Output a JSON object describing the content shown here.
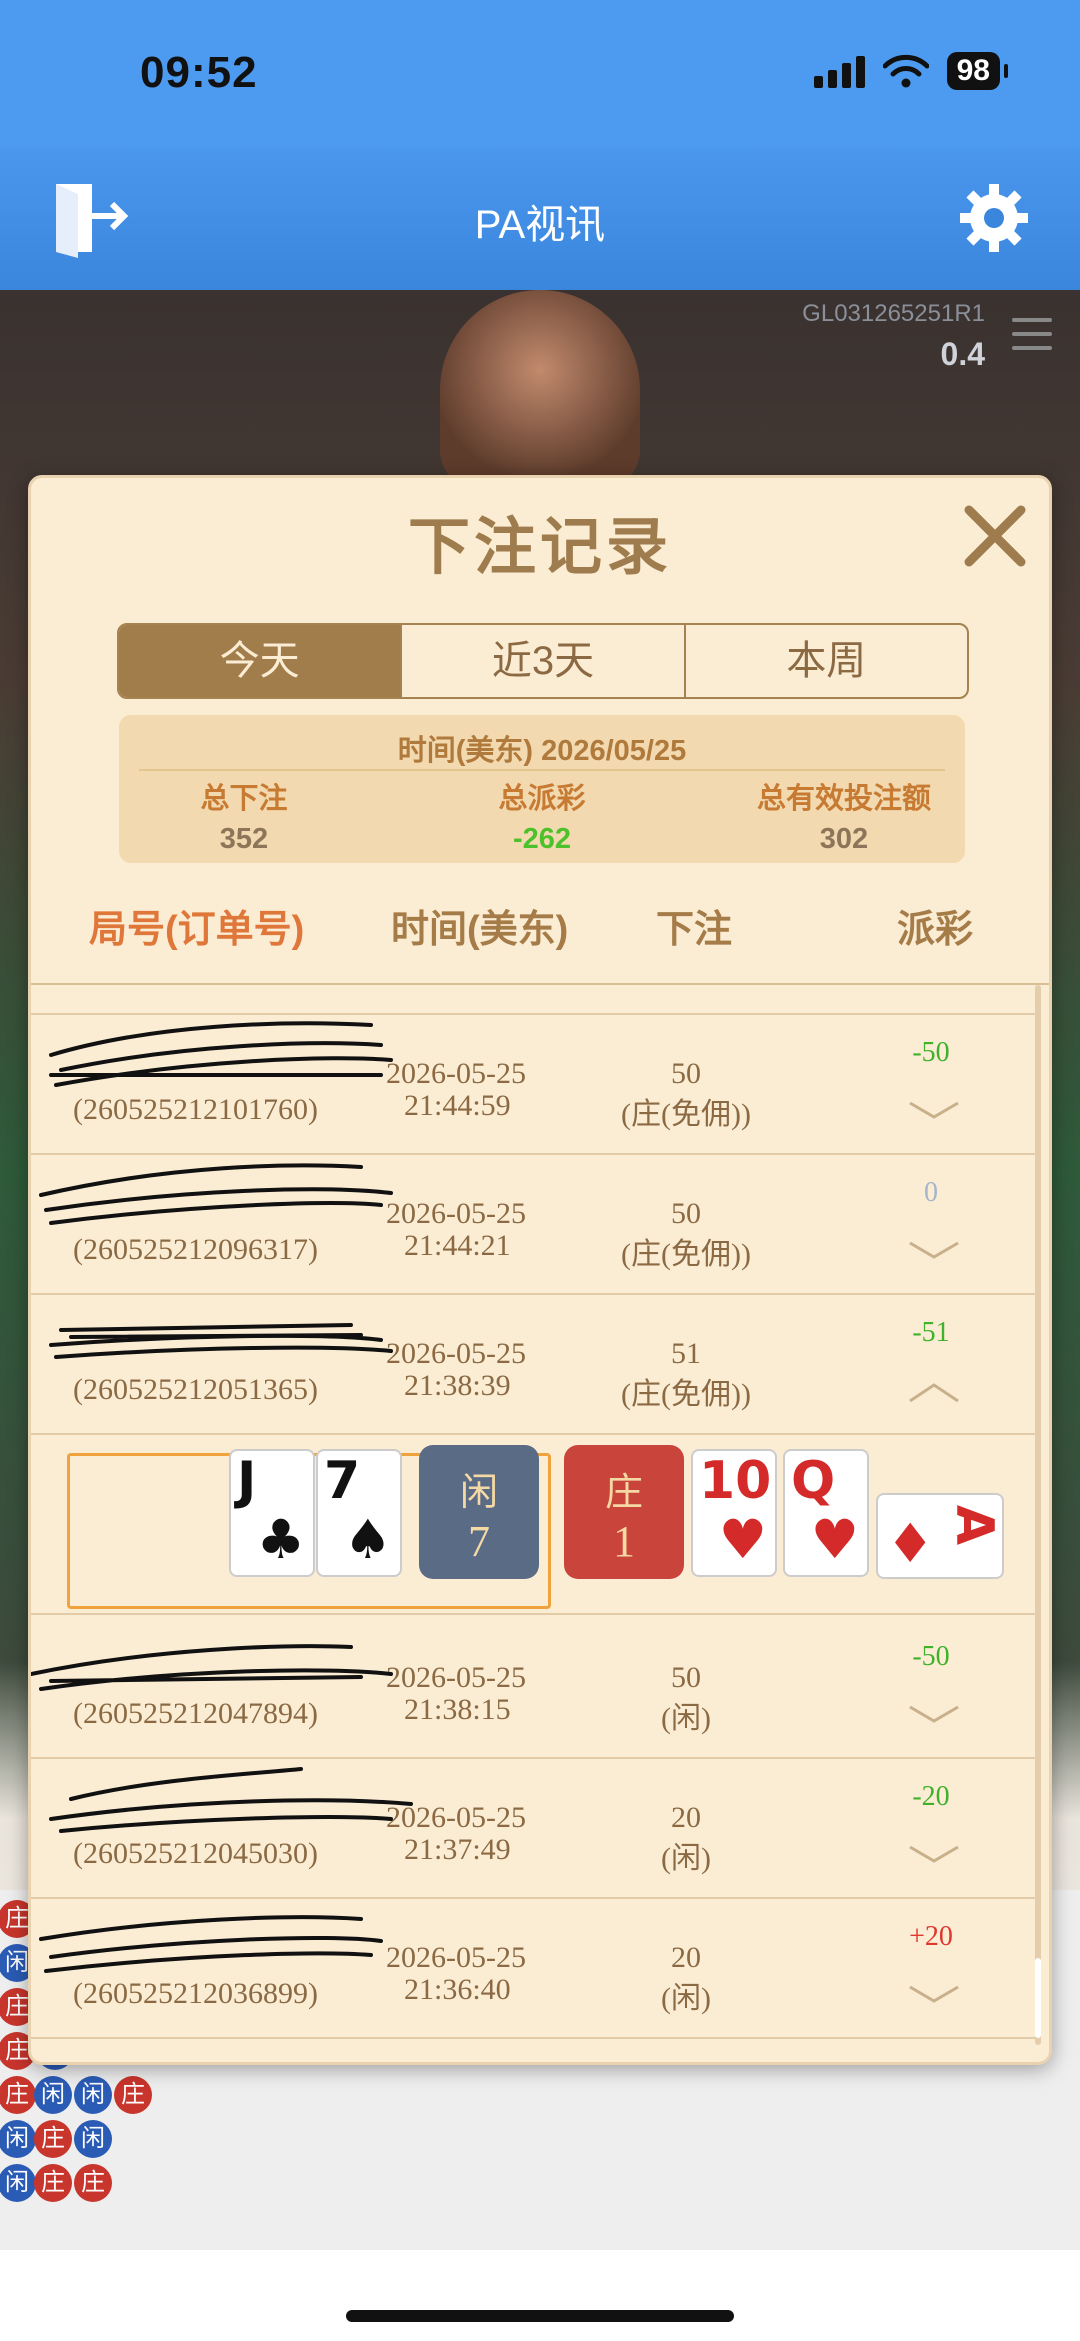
{
  "status_bar": {
    "time": "09:52",
    "battery": "98"
  },
  "header": {
    "title": "PA视讯"
  },
  "table_info": {
    "id": "GL031265251R1",
    "odds": "0.4"
  },
  "modal": {
    "title": "下注记录",
    "tabs": [
      {
        "label": "今天",
        "active": true
      },
      {
        "label": "近3天",
        "active": false
      },
      {
        "label": "本周",
        "active": false
      }
    ],
    "summary": {
      "time_label": "时间(美东) 2026/05/25",
      "total_bet_label": "总下注",
      "total_bet": "352",
      "total_payout_label": "总派彩",
      "total_payout": "-262",
      "total_valid_label": "总有效投注额",
      "total_valid": "302"
    },
    "columns": [
      "局号(订单号)",
      "时间(美东)",
      "下注",
      "派彩"
    ],
    "rows": [
      {
        "order": "(260525212101760)",
        "date": "2026-05-25",
        "time": "21:44:59",
        "amount": "50",
        "side": "(庄(免佣))",
        "payout": "-50",
        "kind": "neg",
        "expanded": false
      },
      {
        "order": "(260525212096317)",
        "date": "2026-05-25",
        "time": "21:44:21",
        "amount": "50",
        "side": "(庄(免佣))",
        "payout": "0",
        "kind": "zero",
        "expanded": false
      },
      {
        "order": "(260525212051365)",
        "date": "2026-05-25",
        "time": "21:38:39",
        "amount": "51",
        "side": "(庄(免佣))",
        "payout": "-51",
        "kind": "neg",
        "expanded": true
      },
      {
        "order": "(260525212047894)",
        "date": "2026-05-25",
        "time": "21:38:15",
        "amount": "50",
        "side": "(闲)",
        "payout": "-50",
        "kind": "neg",
        "expanded": false
      },
      {
        "order": "(260525212045030)",
        "date": "2026-05-25",
        "time": "21:37:49",
        "amount": "20",
        "side": "(闲)",
        "payout": "-20",
        "kind": "neg",
        "expanded": false
      },
      {
        "order": "(260525212036899)",
        "date": "2026-05-25",
        "time": "21:36:40",
        "amount": "20",
        "side": "(闲)",
        "payout": "+20",
        "kind": "pos",
        "expanded": false
      }
    ],
    "detail": {
      "player_cards": [
        {
          "rank": "J",
          "suit": "♣",
          "color": "blk"
        },
        {
          "rank": "7",
          "suit": "♠",
          "color": "blk"
        }
      ],
      "player_label": "闲",
      "player_score": "7",
      "banker_label": "庄",
      "banker_score": "1",
      "banker_cards": [
        {
          "rank": "10",
          "suit": "♥",
          "color": "red"
        },
        {
          "rank": "Q",
          "suit": "♥",
          "color": "red"
        },
        {
          "rank": "A",
          "suit": "♦",
          "color": "red"
        }
      ]
    }
  },
  "roadmap": {
    "beads": [
      "庄",
      "闲",
      "庄",
      "庄",
      "庄",
      "闲",
      "闲",
      "闲",
      "庄",
      "庄",
      "闲",
      "闲",
      "庄",
      "庄",
      "闲"
    ]
  }
}
